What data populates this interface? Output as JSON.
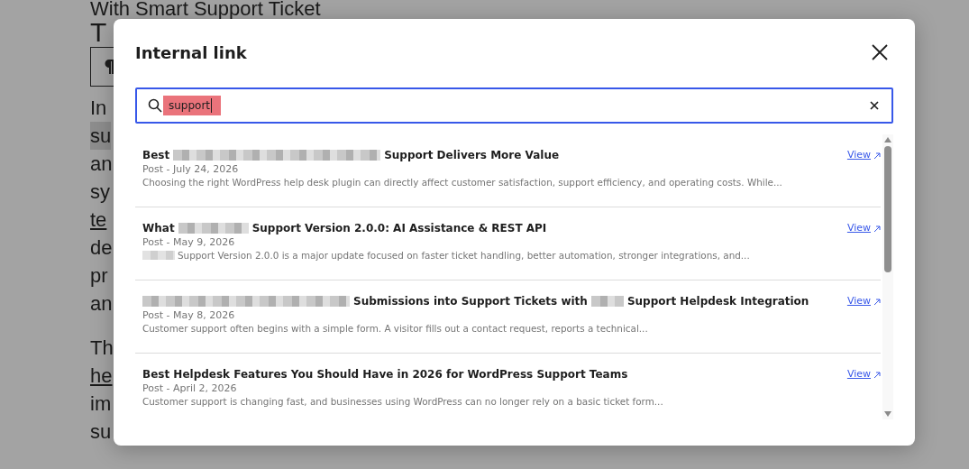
{
  "page": {
    "heading": "With Smart Support Ticket",
    "heading_line_2": "T",
    "paragraphs": [
      [
        {
          "text": "In",
          "kind": "plain"
        },
        {
          "text": "su",
          "kind": "highlight"
        },
        {
          "text": "an",
          "kind": "plain"
        },
        {
          "text": "sy",
          "kind": "plain"
        },
        {
          "text": "te",
          "kind": "link"
        },
        {
          "text": "de",
          "kind": "plain"
        },
        {
          "text": "pr",
          "kind": "plain"
        },
        {
          "text": "an",
          "kind": "plain"
        }
      ],
      [
        {
          "text": "Th",
          "kind": "plain"
        },
        {
          "text": "he",
          "kind": "link"
        },
        {
          "text": "im",
          "kind": "plain"
        },
        {
          "text": "su",
          "kind": "plain"
        }
      ]
    ]
  },
  "dialog": {
    "title": "Internal link",
    "search": {
      "value": "support",
      "selected_text": true
    },
    "results": [
      {
        "title": [
          {
            "kind": "text",
            "text": "Best"
          },
          {
            "kind": "redacted-long"
          },
          {
            "kind": "text",
            "text": "Support Delivers More Value"
          }
        ],
        "meta": "Post - July 24, 2026",
        "excerpt": [
          {
            "kind": "text",
            "text": "Choosing the right WordPress help desk plugin can directly affect customer satisfaction, support efficiency, and operating costs. While..."
          }
        ],
        "link": "View"
      },
      {
        "title": [
          {
            "kind": "text",
            "text": "What"
          },
          {
            "kind": "redacted-medium"
          },
          {
            "kind": "text",
            "text": "Support Version 2.0.0: AI Assistance & REST API"
          }
        ],
        "meta": "Post - May 9, 2026",
        "excerpt": [
          {
            "kind": "redacted-short"
          },
          {
            "kind": "text",
            "text": "Support Version 2.0.0 is a major update focused on faster ticket handling, better automation, stronger integrations, and..."
          }
        ],
        "link": "View"
      },
      {
        "title": [
          {
            "kind": "redacted-long"
          },
          {
            "kind": "text",
            "text": "Submissions into Support Tickets with"
          },
          {
            "kind": "redacted-short"
          },
          {
            "kind": "text",
            "text": "Support Helpdesk Integration"
          }
        ],
        "meta": "Post - May 8, 2026",
        "excerpt": [
          {
            "kind": "text",
            "text": "Customer support often begins with a simple form. A visitor fills out a contact request, reports a technical..."
          }
        ],
        "link": "View"
      },
      {
        "title": [
          {
            "kind": "text",
            "text": "Best Helpdesk Features You Should Have in 2026 for WordPress Support Teams"
          }
        ],
        "meta": "Post - April 2, 2026",
        "excerpt": [
          {
            "kind": "text",
            "text": "Customer support is changing fast, and businesses using WordPress can no longer rely on a basic ticket form..."
          }
        ],
        "link": "View"
      }
    ]
  }
}
